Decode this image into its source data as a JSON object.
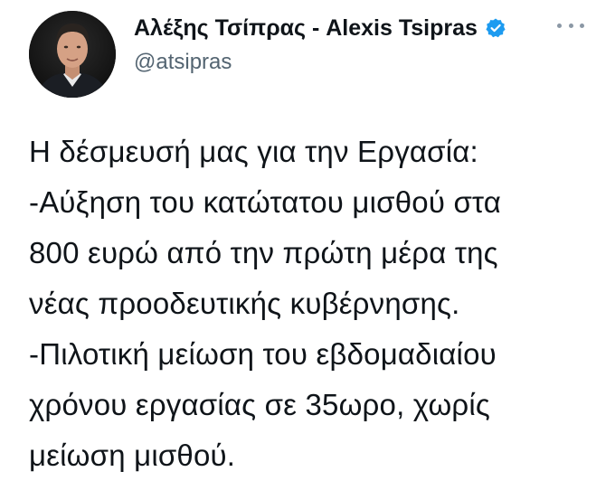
{
  "author": {
    "display_name": "Αλέξης Τσίπρας - Alexis Tsipras",
    "handle": "@atsipras",
    "avatar_icon": "profile-photo",
    "verified_icon": "verified-badge-icon",
    "verified_color": "#1d9bf0"
  },
  "actions": {
    "more_icon": "more-options-icon"
  },
  "tweet": {
    "lines": [
      "Η δέσμευσή μας για την Εργασία:",
      "-Αύξηση του κατώτατου μισθού στα",
      "800 ευρώ από την πρώτη μέρα της",
      "νέας προοδευτικής κυβέρνησης.",
      "-Πιλοτική μείωση του εβδομαδιαίου",
      "χρόνου εργασίας σε 35ωρο, χωρίς",
      "μείωση μισθού."
    ]
  }
}
